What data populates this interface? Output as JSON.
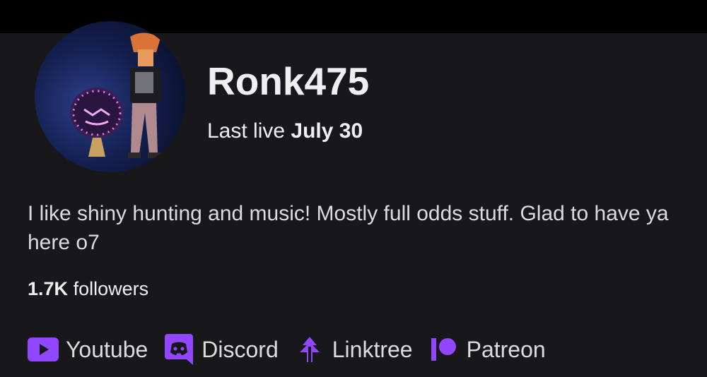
{
  "profile": {
    "channel_name": "Ronk475",
    "last_live_prefix": "Last live",
    "last_live_date": "July 30",
    "bio": "I like shiny hunting and music! Mostly full odds stuff. Glad to have ya here o7",
    "followers_count": "1.7K",
    "followers_label": "followers"
  },
  "social_links": [
    {
      "label": "Youtube",
      "icon": "youtube-icon"
    },
    {
      "label": "Discord",
      "icon": "discord-icon"
    },
    {
      "label": "Linktree",
      "icon": "linktree-icon"
    },
    {
      "label": "Patreon",
      "icon": "patreon-icon"
    }
  ],
  "colors": {
    "background": "#18181b",
    "top_bar": "#000000",
    "accent": "#9147ff",
    "text": "#efeff1"
  }
}
